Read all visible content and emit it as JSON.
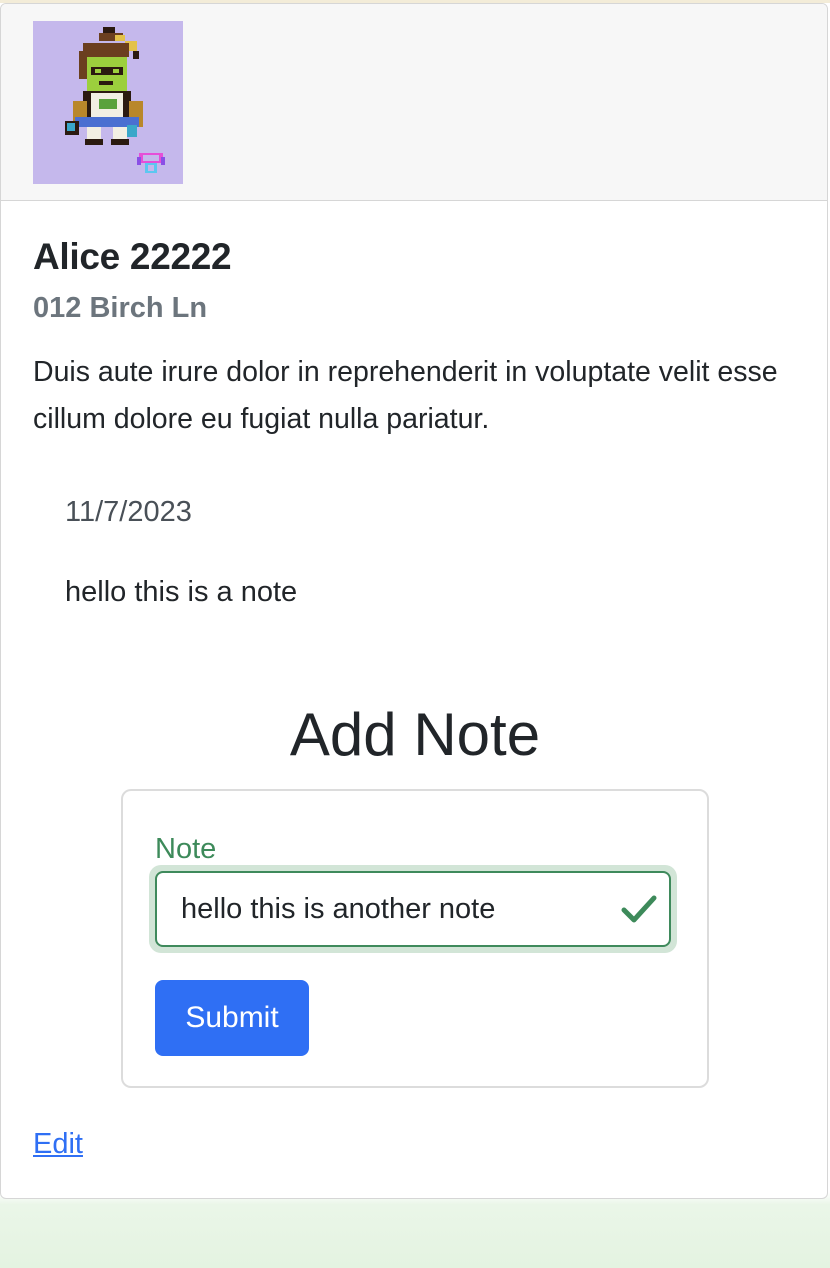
{
  "profile": {
    "name": "Alice 22222",
    "address": "012 Birch Ln",
    "description": "Duis aute irure dolor in reprehenderit in voluptate velit esse cillum dolore eu fugiat nulla pariatur.",
    "avatar_icon": "pixel-art-avatar-icon"
  },
  "notes": [
    {
      "date": "11/7/2023",
      "text": "hello this is a note"
    }
  ],
  "add_note": {
    "title": "Add Note",
    "field_label": "Note",
    "field_value": "hello this is another note",
    "valid_icon": "check-icon",
    "submit_label": "Submit"
  },
  "edit_link": "Edit",
  "colors": {
    "primary": "#2f6ff4",
    "valid": "#3d8a5a",
    "avatar_bg": "#c5b8ec"
  }
}
